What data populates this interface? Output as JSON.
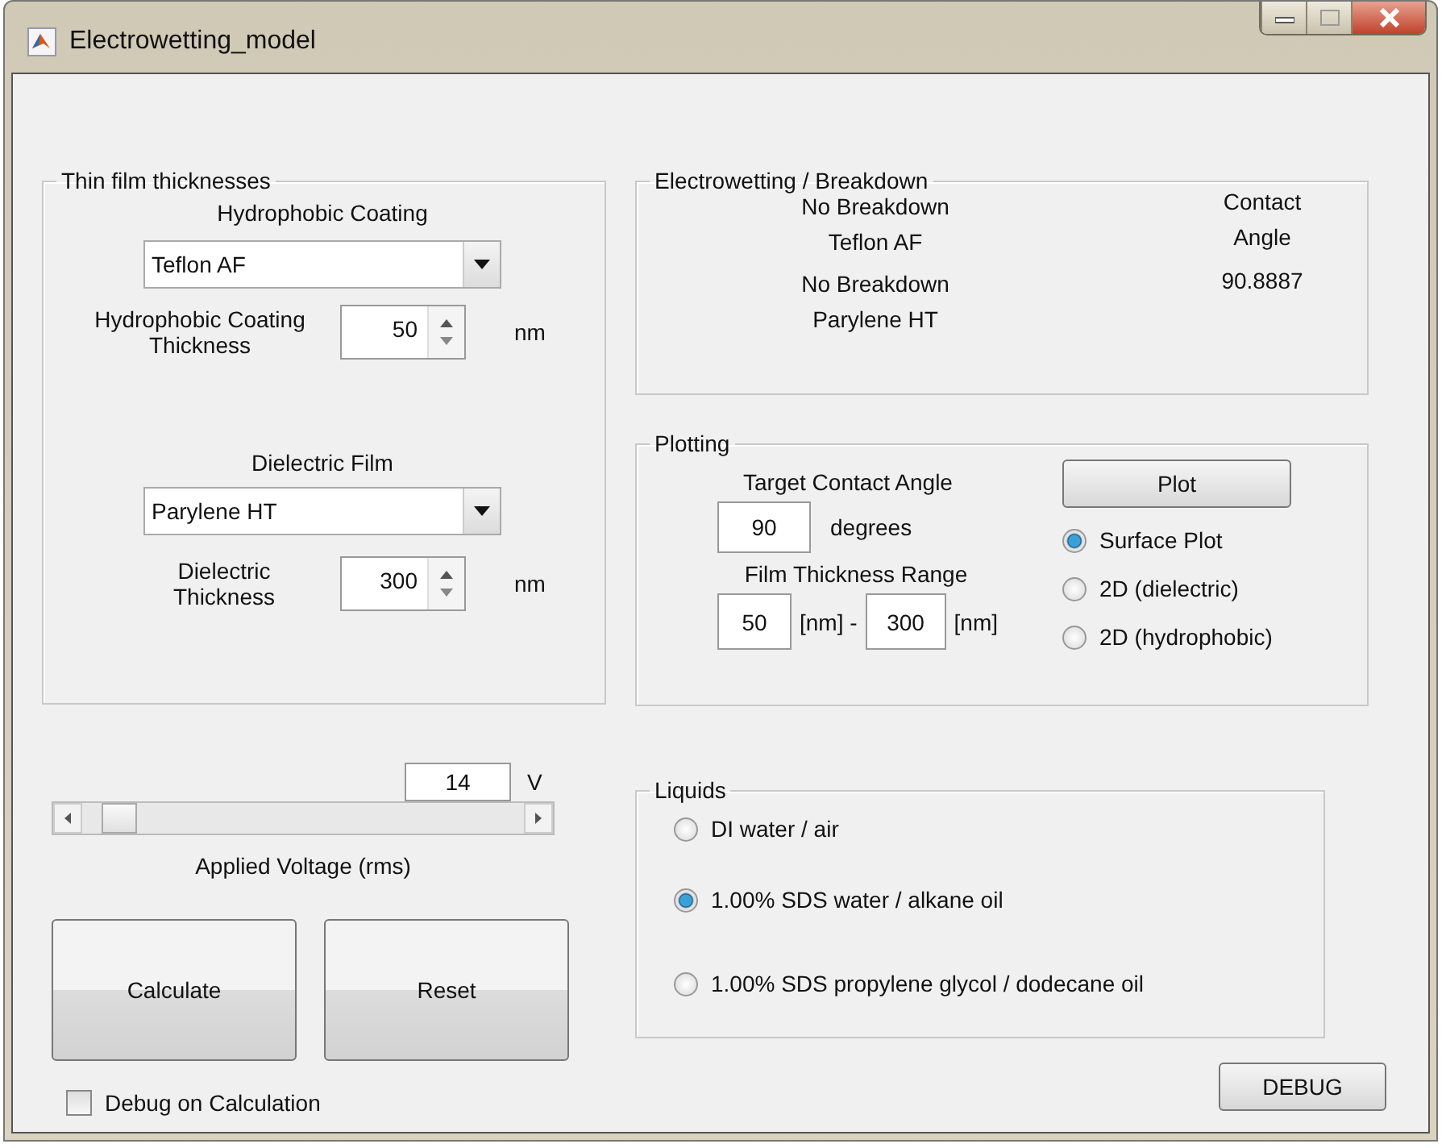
{
  "window": {
    "title": "Electrowetting_model"
  },
  "thin_film": {
    "title": "Thin film thicknesses",
    "hydrophobic_coating": {
      "label": "Hydrophobic Coating",
      "value": "Teflon AF"
    },
    "coating_thickness": {
      "label": "Hydrophobic Coating Thickness",
      "value": "50",
      "unit": "nm"
    },
    "dielectric_film": {
      "label": "Dielectric Film",
      "value": "Parylene HT"
    },
    "dielectric_thickness": {
      "label": "Dielectric Thickness",
      "value": "300",
      "unit": "nm"
    }
  },
  "voltage": {
    "value": "14",
    "unit": "V",
    "label": "Applied Voltage (rms)"
  },
  "buttons": [
    "Calculate",
    "Reset"
  ],
  "debug_on_calculation": {
    "label": "Debug on Calculation",
    "checked": false
  },
  "electrowetting": {
    "title": "Electrowetting / Breakdown",
    "status": [
      "No Breakdown",
      "Teflon AF",
      "No Breakdown",
      "Parylene HT"
    ],
    "contact_angle_label": "Contact Angle",
    "contact_angle": "90.8887"
  },
  "plotting": {
    "title": "Plotting",
    "target_label": "Target Contact Angle",
    "target_value": "90",
    "target_unit": "degrees",
    "range_label": "Film Thickness Range",
    "range_from": "50",
    "range_from_unit": "[nm] -",
    "range_to": "300",
    "range_to_unit": "[nm]",
    "plot_button": "Plot",
    "plot_types": [
      {
        "label": "Surface Plot",
        "selected": true
      },
      {
        "label": "2D (dielectric)",
        "selected": false
      },
      {
        "label": "2D (hydrophobic)",
        "selected": false
      }
    ]
  },
  "liquids": {
    "title": "Liquids",
    "options": [
      {
        "label": "DI water / air",
        "selected": false
      },
      {
        "label": "1.00% SDS water / alkane oil",
        "selected": true
      },
      {
        "label": "1.00% SDS propylene glycol / dodecane oil",
        "selected": false
      }
    ]
  },
  "debug_button": "DEBUG"
}
